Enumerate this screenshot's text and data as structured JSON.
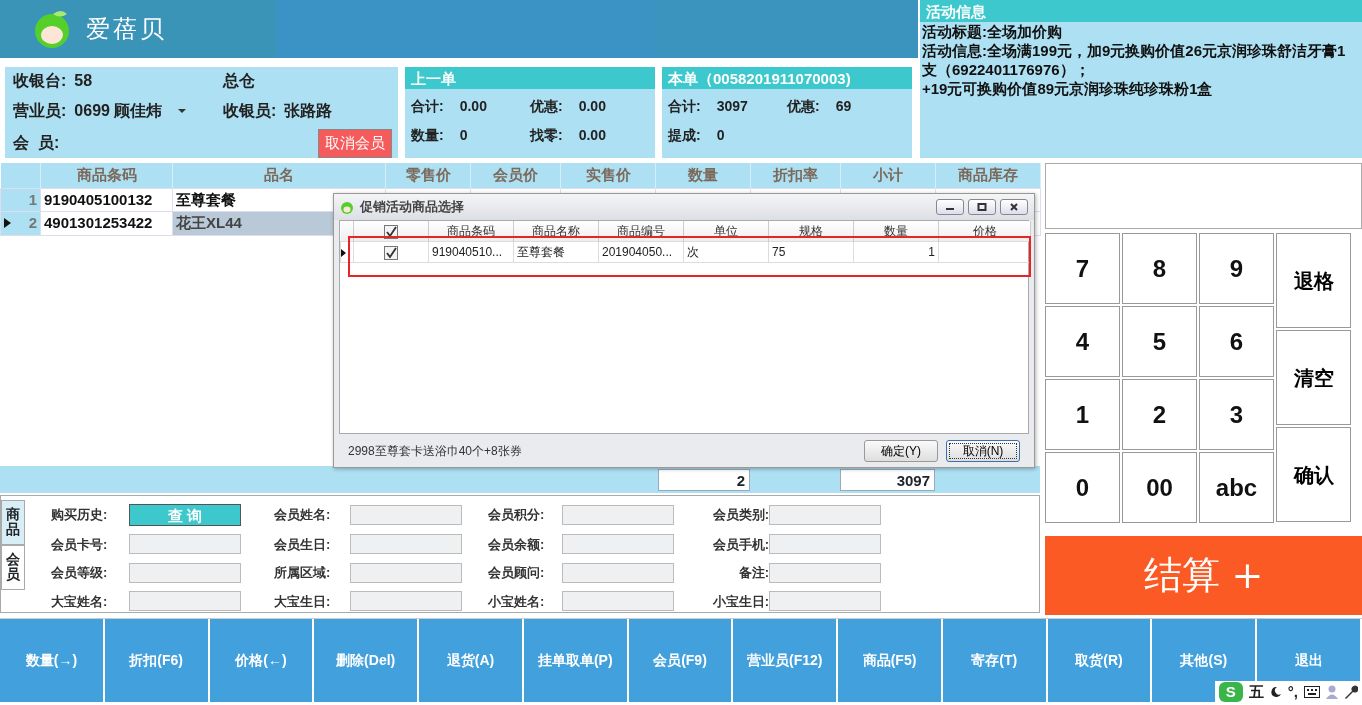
{
  "app": {
    "title": "爱蓓贝"
  },
  "cashier_panel": {
    "register_label": "收银台:",
    "register": "58",
    "warehouse": "总仓",
    "salesperson_label": "营业员:",
    "salesperson": "0699 顾佳炜",
    "cashier_label": "收银员:",
    "cashier": "张路路",
    "member_label": "会  员:",
    "cancel_member_button": "取消会员"
  },
  "last_order": {
    "title": "上一单",
    "fields": [
      {
        "label": "合计:",
        "value": "0.00"
      },
      {
        "label": "优惠:",
        "value": "0.00"
      },
      {
        "label": "数量:",
        "value": "0"
      },
      {
        "label": "找零:",
        "value": "0.00"
      }
    ]
  },
  "current_order": {
    "title": "本单（0058201911070003)",
    "fields": [
      {
        "label": "合计:",
        "value": "3097"
      },
      {
        "label": "优惠:",
        "value": "69"
      },
      {
        "label": "提成:",
        "value": "0"
      }
    ]
  },
  "activity": {
    "title": "活动信息",
    "lines": [
      "活动标题:全场加价购",
      "活动信息:全场满199元，加9元换购价值26元京润珍珠舒洁牙膏1支（6922401176976）；",
      "+19元可换购价值89元京润珍珠纯珍珠粉1盒"
    ]
  },
  "grid": {
    "columns": [
      "商品条码",
      "品名",
      "零售价",
      "会员价",
      "实售价",
      "数量",
      "折扣率",
      "小计",
      "商品库存"
    ],
    "rows": [
      {
        "number": "1",
        "barcode": "9190405100132",
        "name": "至尊套餐",
        "selected": false
      },
      {
        "number": "2",
        "barcode": "4901301253422",
        "name": "花王XL44",
        "selected": true
      }
    ],
    "footer": {
      "quantity": "2",
      "subtotal": "3097"
    }
  },
  "dialog": {
    "title": "促销活动商品选择",
    "header_checked": true,
    "columns": [
      "商品条码",
      "商品名称",
      "商品编号",
      "单位",
      "规格",
      "数量",
      "价格"
    ],
    "rows": [
      {
        "checked": true,
        "selected": true,
        "cells": [
          "919040510...",
          "至尊套餐",
          "201904050...",
          "次",
          "75",
          "1"
        ]
      }
    ],
    "description": "2998至尊套卡送浴巾40个+8张券",
    "buttons": [
      {
        "label": "确定(Y)",
        "focused": false
      },
      {
        "label": "取消(N)",
        "focused": true
      }
    ]
  },
  "member_panel": {
    "tabs": [
      {
        "label": "商品",
        "selected": false
      },
      {
        "label": "会员",
        "selected": true
      }
    ],
    "history_label": "购买历史:",
    "query_button": "查 询",
    "fields": [
      "会员姓名:",
      "会员积分:",
      "会员类别:",
      "会员卡号:",
      "会员生日:",
      "会员余额:",
      "会员手机:",
      "会员等级:",
      "所属区域:",
      "会员顾问:",
      "备注:",
      "大宝姓名:",
      "大宝生日:",
      "小宝姓名:",
      "小宝生日:"
    ]
  },
  "keypad": {
    "keys": [
      "7",
      "8",
      "9",
      "4",
      "5",
      "6",
      "1",
      "2",
      "3",
      "0",
      "00",
      "abc"
    ],
    "side_keys": [
      "退格",
      "清空",
      "确认"
    ],
    "checkout_button": "结算 +"
  },
  "toolbar": [
    "数量(→)",
    "折扣(F6)",
    "价格(←)",
    "删除(Del)",
    "退货(A)",
    "挂单取单(P)",
    "会员(F9)",
    "营业员(F12)",
    "商品(F5)",
    "寄存(T)",
    "取货(R)",
    "其他(S)",
    "退出"
  ],
  "tray": {
    "logo": "S",
    "mode": "五",
    "punctuation": "°,"
  }
}
